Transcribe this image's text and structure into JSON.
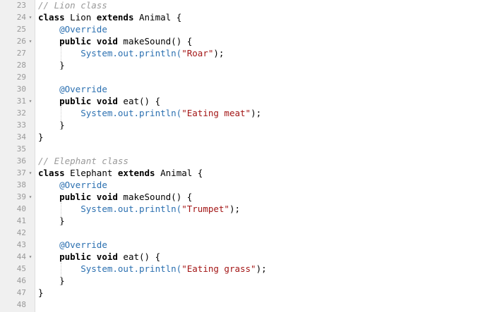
{
  "editor": {
    "lines": [
      {
        "num": "23",
        "fold": false,
        "tokens": [
          {
            "t": "// Lion class",
            "c": "cm"
          }
        ]
      },
      {
        "num": "24",
        "fold": true,
        "tokens": [
          {
            "t": "class",
            "c": "kw"
          },
          {
            "t": " Lion ",
            "c": "tx"
          },
          {
            "t": "extends",
            "c": "kw"
          },
          {
            "t": " Animal {",
            "c": "tx"
          }
        ]
      },
      {
        "num": "25",
        "fold": false,
        "tokens": [
          {
            "t": "    ",
            "c": "tx"
          },
          {
            "t": "@Override",
            "c": "an"
          }
        ]
      },
      {
        "num": "26",
        "fold": true,
        "tokens": [
          {
            "t": "    ",
            "c": "tx"
          },
          {
            "t": "public",
            "c": "kw"
          },
          {
            "t": " ",
            "c": "tx"
          },
          {
            "t": "void",
            "c": "kw"
          },
          {
            "t": " makeSound() {",
            "c": "tx"
          }
        ]
      },
      {
        "num": "27",
        "fold": false,
        "tokens": [
          {
            "t": "        ",
            "c": "tx"
          },
          {
            "t": "System.out.println(",
            "c": "fn"
          },
          {
            "t": "\"Roar\"",
            "c": "st"
          },
          {
            "t": ");",
            "c": "tx"
          }
        ]
      },
      {
        "num": "28",
        "fold": false,
        "tokens": [
          {
            "t": "    }",
            "c": "tx"
          }
        ]
      },
      {
        "num": "29",
        "fold": false,
        "tokens": []
      },
      {
        "num": "30",
        "fold": false,
        "tokens": [
          {
            "t": "    ",
            "c": "tx"
          },
          {
            "t": "@Override",
            "c": "an"
          }
        ]
      },
      {
        "num": "31",
        "fold": true,
        "tokens": [
          {
            "t": "    ",
            "c": "tx"
          },
          {
            "t": "public",
            "c": "kw"
          },
          {
            "t": " ",
            "c": "tx"
          },
          {
            "t": "void",
            "c": "kw"
          },
          {
            "t": " eat() {",
            "c": "tx"
          }
        ]
      },
      {
        "num": "32",
        "fold": false,
        "tokens": [
          {
            "t": "        ",
            "c": "tx"
          },
          {
            "t": "System.out.println(",
            "c": "fn"
          },
          {
            "t": "\"Eating meat\"",
            "c": "st"
          },
          {
            "t": ");",
            "c": "tx"
          }
        ]
      },
      {
        "num": "33",
        "fold": false,
        "tokens": [
          {
            "t": "    }",
            "c": "tx"
          }
        ]
      },
      {
        "num": "34",
        "fold": false,
        "tokens": [
          {
            "t": "}",
            "c": "tx"
          }
        ]
      },
      {
        "num": "35",
        "fold": false,
        "tokens": []
      },
      {
        "num": "36",
        "fold": false,
        "tokens": [
          {
            "t": "// Elephant class",
            "c": "cm"
          }
        ]
      },
      {
        "num": "37",
        "fold": true,
        "tokens": [
          {
            "t": "class",
            "c": "kw"
          },
          {
            "t": " Elephant ",
            "c": "tx"
          },
          {
            "t": "extends",
            "c": "kw"
          },
          {
            "t": " Animal {",
            "c": "tx"
          }
        ]
      },
      {
        "num": "38",
        "fold": false,
        "tokens": [
          {
            "t": "    ",
            "c": "tx"
          },
          {
            "t": "@Override",
            "c": "an"
          }
        ]
      },
      {
        "num": "39",
        "fold": true,
        "tokens": [
          {
            "t": "    ",
            "c": "tx"
          },
          {
            "t": "public",
            "c": "kw"
          },
          {
            "t": " ",
            "c": "tx"
          },
          {
            "t": "void",
            "c": "kw"
          },
          {
            "t": " makeSound() {",
            "c": "tx"
          }
        ]
      },
      {
        "num": "40",
        "fold": false,
        "tokens": [
          {
            "t": "        ",
            "c": "tx"
          },
          {
            "t": "System.out.println(",
            "c": "fn"
          },
          {
            "t": "\"Trumpet\"",
            "c": "st"
          },
          {
            "t": ");",
            "c": "tx"
          }
        ]
      },
      {
        "num": "41",
        "fold": false,
        "tokens": [
          {
            "t": "    }",
            "c": "tx"
          }
        ]
      },
      {
        "num": "42",
        "fold": false,
        "tokens": []
      },
      {
        "num": "43",
        "fold": false,
        "tokens": [
          {
            "t": "    ",
            "c": "tx"
          },
          {
            "t": "@Override",
            "c": "an"
          }
        ]
      },
      {
        "num": "44",
        "fold": true,
        "tokens": [
          {
            "t": "    ",
            "c": "tx"
          },
          {
            "t": "public",
            "c": "kw"
          },
          {
            "t": " ",
            "c": "tx"
          },
          {
            "t": "void",
            "c": "kw"
          },
          {
            "t": " eat() {",
            "c": "tx"
          }
        ]
      },
      {
        "num": "45",
        "fold": false,
        "tokens": [
          {
            "t": "        ",
            "c": "tx"
          },
          {
            "t": "System.out.println(",
            "c": "fn"
          },
          {
            "t": "\"Eating grass\"",
            "c": "st"
          },
          {
            "t": ");",
            "c": "tx"
          }
        ]
      },
      {
        "num": "46",
        "fold": false,
        "tokens": [
          {
            "t": "    }",
            "c": "tx"
          }
        ]
      },
      {
        "num": "47",
        "fold": false,
        "tokens": [
          {
            "t": "}",
            "c": "tx"
          }
        ]
      },
      {
        "num": "48",
        "fold": false,
        "tokens": []
      }
    ],
    "fold_icon": "fold-arrow-icon",
    "colors": {
      "keyword": "#000000",
      "comment": "#999999",
      "annotation": "#2a6fb0",
      "method": "#2a6fb0",
      "string": "#a31515",
      "gutter_bg": "#f0f0f0",
      "line_number": "#999999"
    }
  }
}
